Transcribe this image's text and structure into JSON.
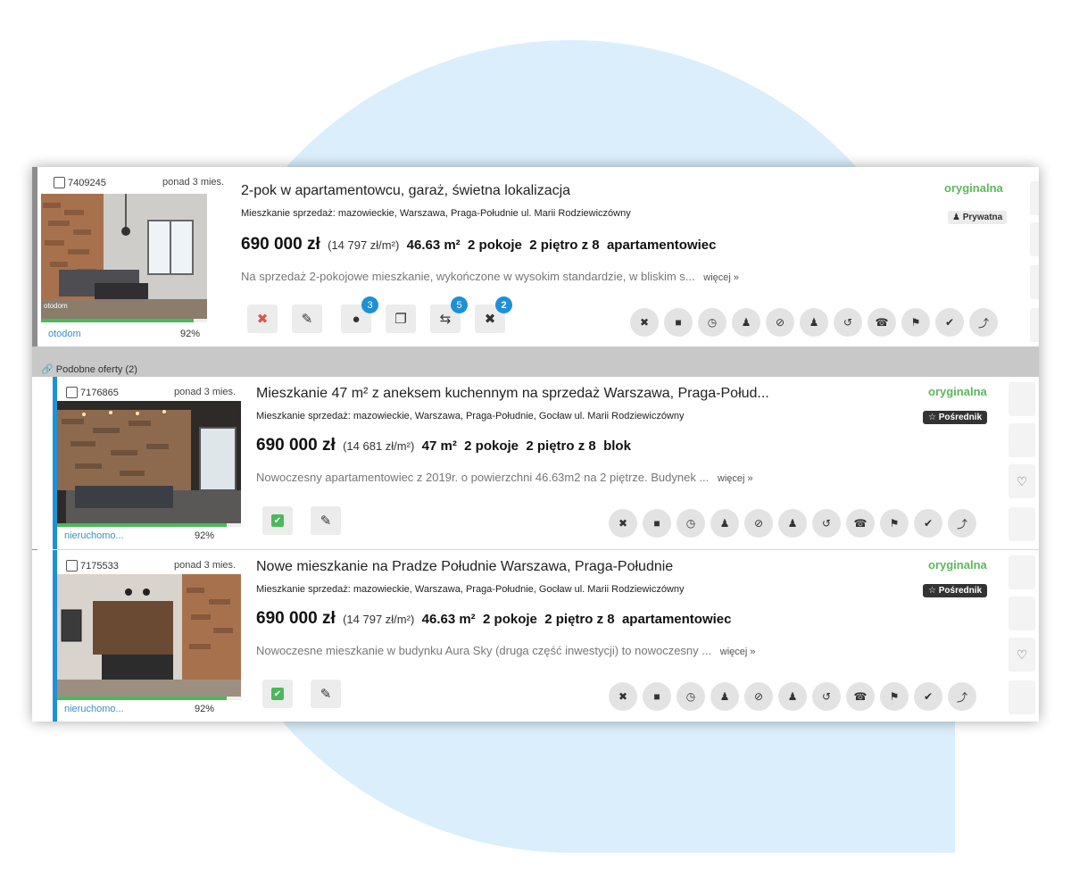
{
  "main": {
    "id": "7409245",
    "age": "ponad 3 mies.",
    "source": "otodom",
    "score": "92%",
    "photo_caption": "otodom",
    "title": "2-pok w apartamentowcu, garaż, świetna lokalizacja",
    "subtitle": "Mieszkanie sprzedaż: mazowieckie, Warszawa, Praga-Południe ul. Marii Rodziewiczówny",
    "price": "690 000 zł",
    "price_per_m2": "(14 797 zł/m²)",
    "area": "46.63 m²",
    "rooms": "2 pokoje",
    "floor": "2 piętro z 8",
    "type": "apartamentowiec",
    "description": "Na sprzedaż 2-pokojowe mieszkanie, wykończone w wysokim standardzie, w bliskim s...",
    "more": "więcej »",
    "status": "oryginalna",
    "owner_badge": "Prywatna",
    "btn_counts": {
      "similar": "3",
      "repeat": "5",
      "rejected": "2"
    }
  },
  "similar_header": "Podobne oferty (2)",
  "similar": [
    {
      "id": "7176865",
      "age": "ponad 3 mies.",
      "source": "nieruchomo...",
      "score": "92%",
      "title": "Mieszkanie 47 m² z aneksem kuchennym na sprzedaż Warszawa, Praga-Połud...",
      "subtitle": "Mieszkanie sprzedaż: mazowieckie, Warszawa, Praga-Południe, Gocław ul. Marii Rodziewiczówny",
      "price": "690 000 zł",
      "price_per_m2": "(14 681 zł/m²)",
      "area": "47 m²",
      "rooms": "2 pokoje",
      "floor": "2 piętro z 8",
      "type": "blok",
      "description": "Nowoczesny apartamentowiec z 2019r. o powierzchni 46.63m2 na 2 piętrze. Budynek ...",
      "more": "więcej »",
      "status": "oryginalna",
      "owner_badge": "Pośrednik"
    },
    {
      "id": "7175533",
      "age": "ponad 3 mies.",
      "source": "nieruchomo...",
      "score": "92%",
      "title": "Nowe mieszkanie na Pradze Południe Warszawa, Praga-Południe",
      "subtitle": "Mieszkanie sprzedaż: mazowieckie, Warszawa, Praga-Południe, Gocław ul. Marii Rodziewiczówny",
      "price": "690 000 zł",
      "price_per_m2": "(14 797 zł/m²)",
      "area": "46.63 m²",
      "rooms": "2 pokoje",
      "floor": "2 piętro z 8",
      "type": "apartamentowiec",
      "description": "Nowoczesne mieszkanie w budynku Aura Sky (druga część inwestycji) to nowoczesny ...",
      "more": "więcej »",
      "status": "oryginalna",
      "owner_badge": "Pośrednik"
    }
  ],
  "colors": {
    "accent_blue": "#1e90d6",
    "original_green": "#5cb85c",
    "background_blob": "#dbeefc"
  }
}
